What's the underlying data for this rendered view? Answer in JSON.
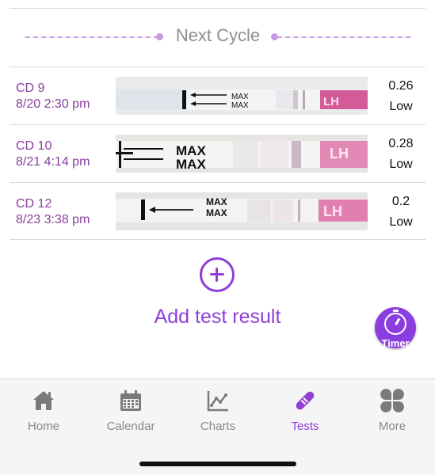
{
  "header": {
    "title": "Next Cycle"
  },
  "tests": [
    {
      "cd": "CD 9",
      "date": "8/20 2:30 pm",
      "value": "0.26",
      "level": "Low",
      "strip_text": [
        "MAX",
        "MAX",
        "LH"
      ]
    },
    {
      "cd": "CD 10",
      "date": "8/21 4:14 pm",
      "value": "0.28",
      "level": "Low",
      "strip_text": [
        "MAX",
        "MAX",
        "LH"
      ]
    },
    {
      "cd": "CD 12",
      "date": "8/23 3:38 pm",
      "value": "0.2",
      "level": "Low",
      "strip_text": [
        "MAX",
        "MAX",
        "LH"
      ]
    }
  ],
  "add": {
    "label": "Add test result",
    "icon": "plus-circle-icon"
  },
  "timer": {
    "label": "Timer",
    "icon": "stopwatch-icon"
  },
  "tabs": [
    {
      "label": "Home",
      "icon": "home-icon",
      "active": false
    },
    {
      "label": "Calendar",
      "icon": "calendar-icon",
      "active": false
    },
    {
      "label": "Charts",
      "icon": "chart-icon",
      "active": false
    },
    {
      "label": "Tests",
      "icon": "test-strip-icon",
      "active": true
    },
    {
      "label": "More",
      "icon": "grid-icon",
      "active": false
    }
  ],
  "colors": {
    "accent": "#8e3fd6",
    "list_text": "#8b3fa0",
    "dash": "#c79ae0",
    "tab_inactive": "#888888"
  }
}
